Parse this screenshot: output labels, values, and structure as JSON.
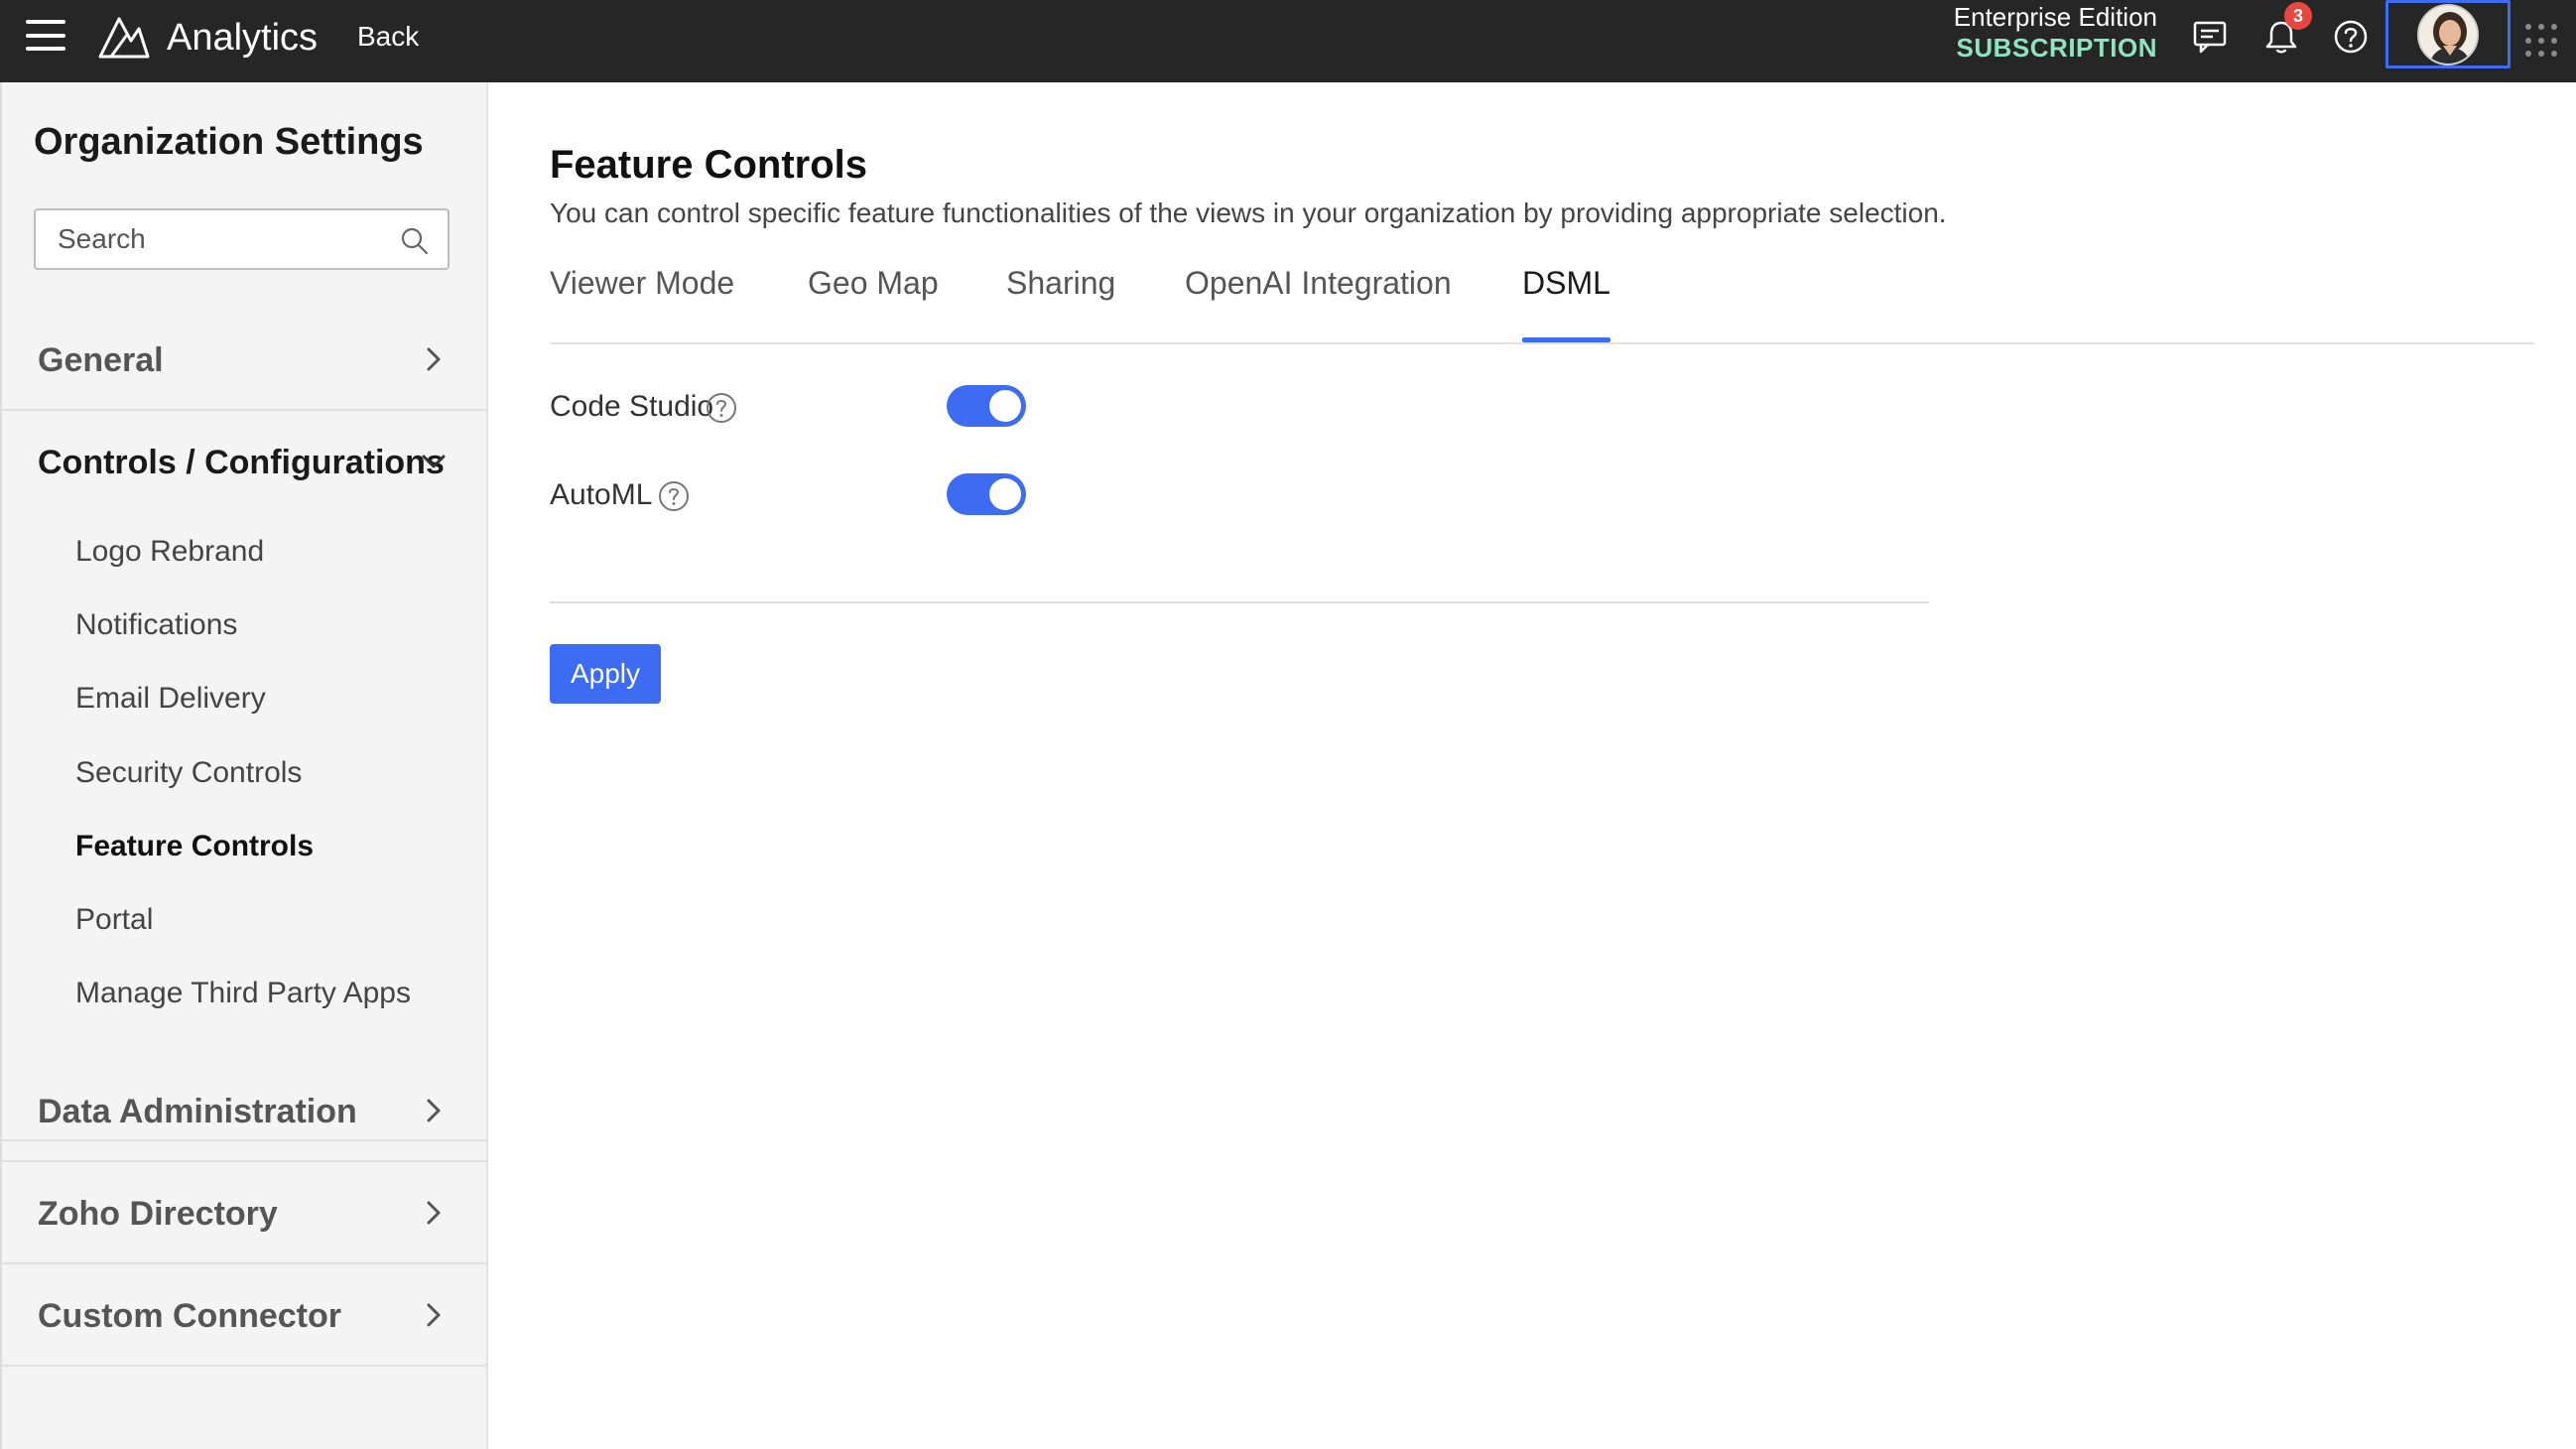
{
  "topbar": {
    "app_name": "Analytics",
    "back_label": "Back",
    "edition_name": "Enterprise Edition",
    "subscription_label": "SUBSCRIPTION",
    "notification_count": "3"
  },
  "sidebar": {
    "title": "Organization Settings",
    "search_placeholder": "Search",
    "sections": {
      "general": "General",
      "controls": "Controls / Configurations",
      "data_admin": "Data Administration",
      "zoho_directory": "Zoho Directory",
      "custom_connector": "Custom Connector"
    },
    "sub_items": {
      "logo_rebrand": "Logo Rebrand",
      "notifications": "Notifications",
      "email_delivery": "Email Delivery",
      "security_controls": "Security Controls",
      "feature_controls": "Feature Controls",
      "portal": "Portal",
      "third_party": "Manage Third Party Apps"
    }
  },
  "main": {
    "title": "Feature Controls",
    "description": "You can control specific feature functionalities of the views in your organization by providing appropriate selection.",
    "tabs": {
      "viewer_mode": "Viewer Mode",
      "geo_map": "Geo Map",
      "sharing": "Sharing",
      "openai": "OpenAI Integration",
      "dsml": "DSML"
    },
    "active_tab": "DSML",
    "settings": {
      "code_studio": {
        "label": "Code Studio",
        "enabled": true
      },
      "automl": {
        "label": "AutoML",
        "enabled": true
      }
    },
    "apply_label": "Apply"
  },
  "colors": {
    "accent": "#3d6cf2",
    "topbar": "#262626",
    "subscription": "#8fe3c0",
    "badge": "#e8473f"
  }
}
